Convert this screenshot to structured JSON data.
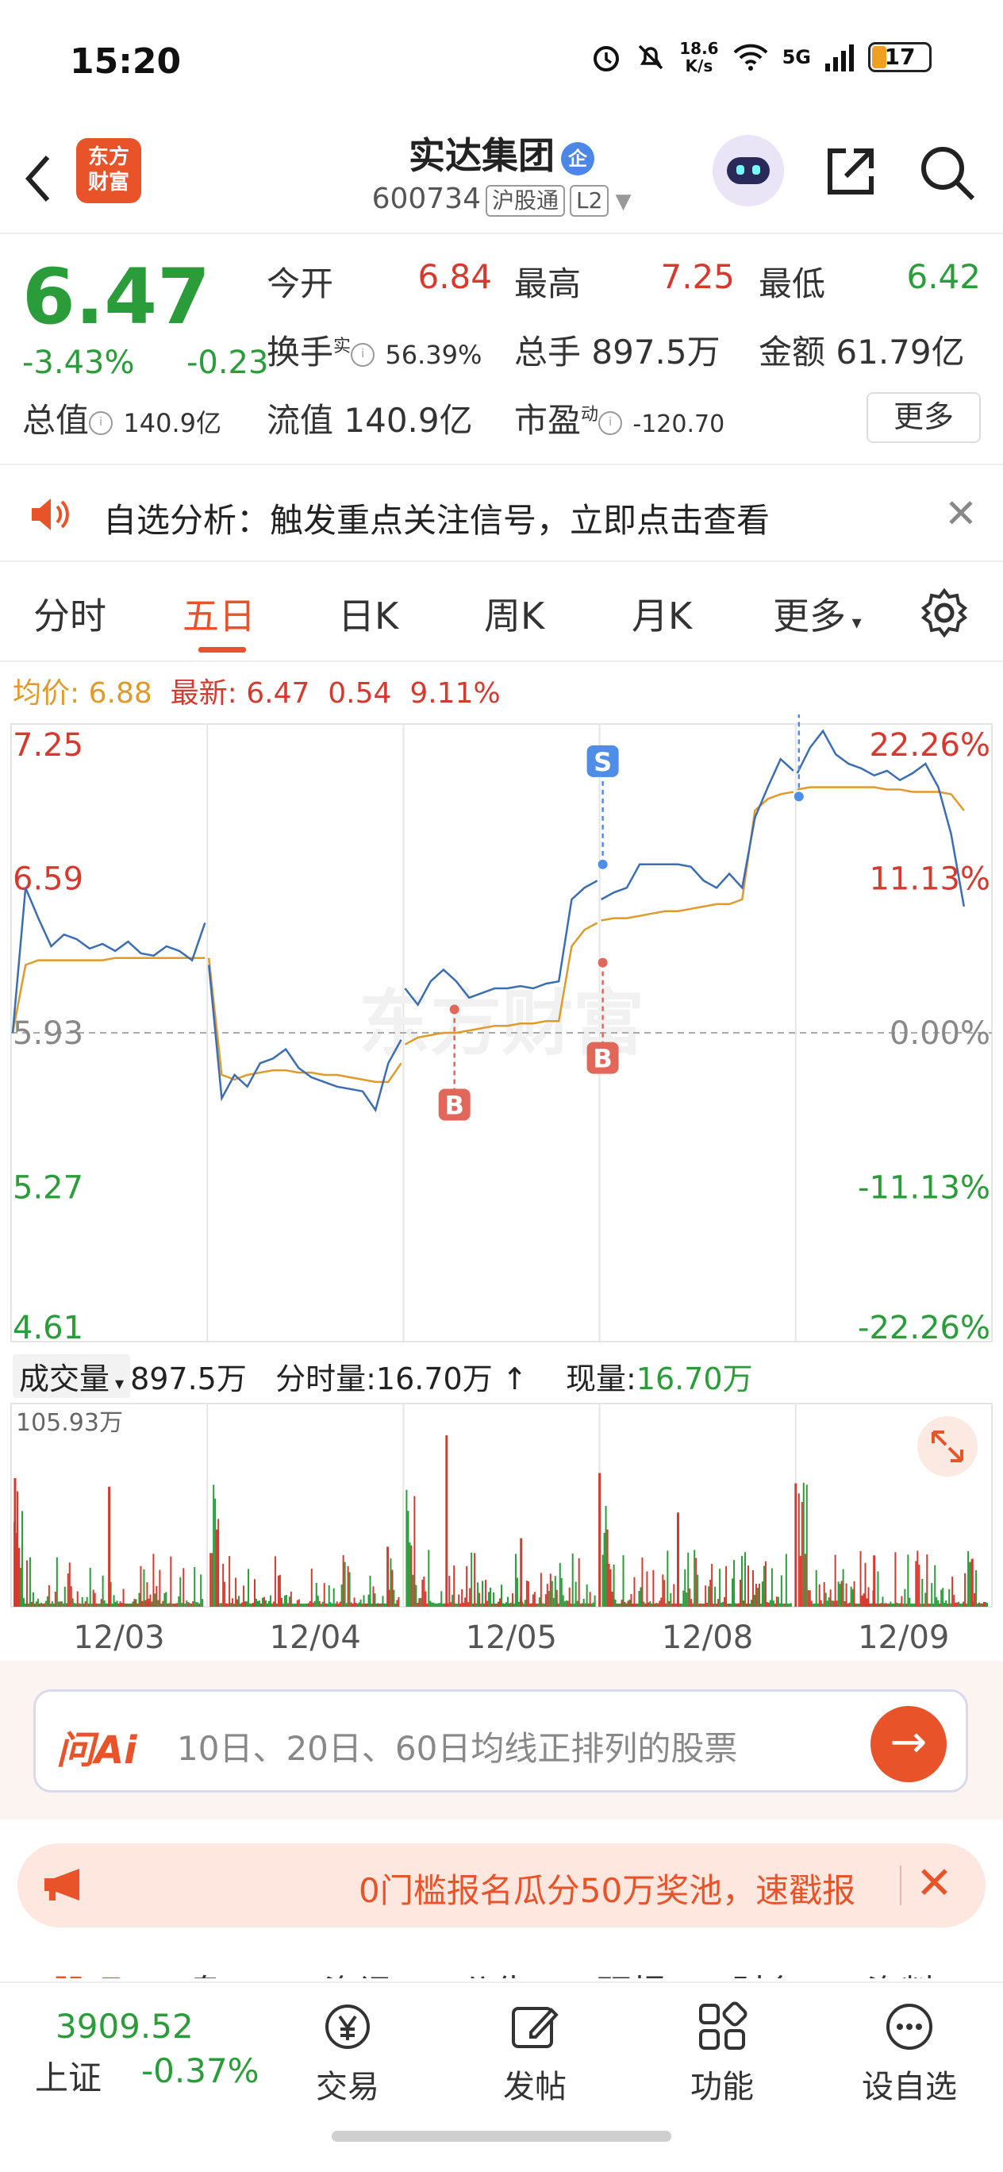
{
  "status_bar": {
    "time": "15:20",
    "net_speed_value": "18.6",
    "net_speed_unit": "K/s",
    "network": "5G",
    "battery": "17"
  },
  "header": {
    "logo_line1": "东方",
    "logo_line2": "财富",
    "title": "实达集团",
    "enterprise_badge": "企",
    "code": "600734",
    "tag1": "沪股通",
    "tag2": "L2"
  },
  "quote": {
    "price": "6.47",
    "change_pct": "-3.43%",
    "change_abs": "-0.23",
    "open_label": "今开",
    "open_value": "6.84",
    "high_label": "最高",
    "high_value": "7.25",
    "low_label": "最低",
    "low_value": "6.42",
    "turnover_label": "换手",
    "turnover_sup": "实",
    "turnover_value": "56.39%",
    "volume_label": "总手",
    "volume_value": "897.5万",
    "amount_label": "金额",
    "amount_value": "61.79亿",
    "mktcap_label": "总值",
    "mktcap_value": "140.9亿",
    "float_label": "流值",
    "float_value": "140.9亿",
    "pe_label": "市盈",
    "pe_sup": "动",
    "pe_value": "-120.70",
    "more_button": "更多"
  },
  "notice": {
    "text": "自选分析：触发重点关注信号，立即点击查看"
  },
  "tabs": {
    "items": [
      "分时",
      "五日",
      "日K",
      "周K",
      "月K",
      "更多"
    ],
    "active": "五日"
  },
  "avg_line": {
    "avg_label": "均价:",
    "avg_value": "6.88",
    "latest_label": "最新:",
    "latest_value": "6.47",
    "diff": "0.54",
    "pct": "9.11%"
  },
  "chart_data": {
    "type": "line",
    "title": "",
    "x_day_labels": [
      "12/03",
      "12/04",
      "12/05",
      "12/08",
      "12/09"
    ],
    "y_left_ticks": [
      "7.25",
      "6.59",
      "5.93",
      "5.27",
      "4.61"
    ],
    "y_right_ticks": [
      "22.26%",
      "11.13%",
      "0.00%",
      "-11.13%",
      "-22.26%"
    ],
    "ylim": [
      4.61,
      7.25
    ],
    "prev_close": 5.93,
    "series": [
      {
        "name": "",
        "values": [
          5.93,
          6.55,
          6.42,
          6.3,
          6.35,
          6.33,
          6.29,
          6.31,
          6.28,
          6.32,
          6.27,
          6.26,
          6.3,
          6.28,
          6.24,
          6.4,
          6.22,
          5.65,
          5.75,
          5.7,
          5.8,
          5.82,
          5.86,
          5.78,
          5.74,
          5.72,
          5.7,
          5.69,
          5.68,
          5.6,
          5.8,
          5.9,
          6.12,
          6.05,
          6.15,
          6.2,
          6.15,
          6.08,
          6.1,
          6.12,
          6.12,
          6.13,
          6.12,
          6.14,
          6.15,
          6.5,
          6.55,
          6.58,
          6.5,
          6.53,
          6.55,
          6.65,
          6.65,
          6.65,
          6.65,
          6.64,
          6.58,
          6.55,
          6.61,
          6.55,
          6.85,
          6.98,
          7.1,
          7.05,
          7.04,
          7.15,
          7.22,
          7.12,
          7.08,
          7.06,
          7.03,
          7.05,
          7.01,
          7.04,
          7.08,
          6.98,
          6.78,
          6.47
        ]
      },
      {
        "name": "",
        "values": [
          5.93,
          6.22,
          6.24,
          6.24,
          6.24,
          6.24,
          6.24,
          6.24,
          6.25,
          6.25,
          6.25,
          6.25,
          6.25,
          6.25,
          6.25,
          6.25,
          6.25,
          5.75,
          5.73,
          5.75,
          5.76,
          5.77,
          5.77,
          5.76,
          5.76,
          5.75,
          5.75,
          5.74,
          5.73,
          5.72,
          5.72,
          5.8,
          5.88,
          5.91,
          5.92,
          5.93,
          5.93,
          5.94,
          5.95,
          5.96,
          5.96,
          5.97,
          5.97,
          5.98,
          5.98,
          6.3,
          6.37,
          6.4,
          6.41,
          6.42,
          6.42,
          6.43,
          6.44,
          6.45,
          6.45,
          6.46,
          6.47,
          6.48,
          6.48,
          6.5,
          6.88,
          6.93,
          6.95,
          6.96,
          6.97,
          6.98,
          6.98,
          6.98,
          6.98,
          6.98,
          6.98,
          6.97,
          6.97,
          6.96,
          6.96,
          6.96,
          6.95,
          6.88
        ]
      }
    ],
    "markers": [
      {
        "label": "B",
        "type": "buy",
        "day_index": 2,
        "price": 6.03
      },
      {
        "label": "B",
        "type": "buy",
        "day_index": 3,
        "price": 6.23
      },
      {
        "label": "S",
        "type": "sell",
        "day_index": 3,
        "price": 6.65
      },
      {
        "label": "S",
        "type": "sell",
        "day_index": 4,
        "price": 6.94
      }
    ],
    "grid": true,
    "watermark": "东方财富"
  },
  "volume": {
    "label": "成交量",
    "total": "897.5万",
    "tick_label": "分时量:",
    "tick_value": "16.70万",
    "current_label": "现量:",
    "current_value": "16.70万",
    "max_label": "105.93万"
  },
  "ask_ai": {
    "brand": "问Ai",
    "placeholder": "10日、20日、60日均线正排列的股票"
  },
  "promo": {
    "text": "0门槛报名瓜分50万奖池，速戳报"
  },
  "sub_tabs": [
    "股吧",
    "盘口",
    "资讯",
    "公告",
    "研报",
    "财务",
    "资料"
  ],
  "bottom_nav": {
    "index_value": "3909.52",
    "index_name": "上证",
    "index_change": "-0.37%",
    "items": [
      "交易",
      "发帖",
      "功能",
      "设自选"
    ]
  },
  "colors": {
    "accent": "#e8532a",
    "up": "#d63a2f",
    "down": "#2a9d3a",
    "price_line": "#3b6db3",
    "avg_line": "#e09a2a"
  }
}
